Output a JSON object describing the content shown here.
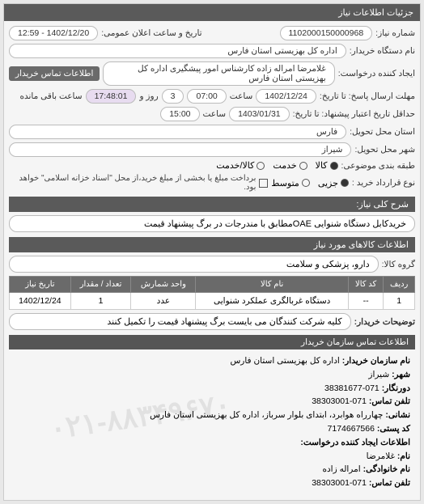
{
  "panel_title": "جزئیات اطلاعات نیاز",
  "header": {
    "req_no_label": "شماره نیاز:",
    "req_no": "1102000150000968",
    "public_announce_label": "تاریخ و ساعت اعلان عمومی:",
    "public_announce": "1402/12/20 - 12:59",
    "buyer_label": "نام دستگاه خریدار:",
    "buyer": "اداره کل بهزیستی استان فارس",
    "req_creator_label": "ایجاد کننده درخواست:",
    "req_creator": "غلامرضا امراله زاده کارشناس امور پیشگیری اداره کل بهزیستی استان فارس",
    "buyer_contact_btn": "اطلاعات تماس خریدار",
    "resp_deadline_label": "مهلت ارسال پاسخ: تا تاریخ:",
    "resp_date": "1402/12/24",
    "resp_time_label": "ساعت",
    "resp_time": "07:00",
    "resp_days_label": "روز و",
    "resp_days": "3",
    "remaining_label": "ساعت باقی مانده",
    "remaining": "17:48:01",
    "to_date_label": "حداقل تاریخ اعتبار پیشنهاد: تا تاریخ:",
    "to_date": "1403/01/31",
    "to_time_label": "ساعت",
    "to_time": "15:00",
    "province_label": "استان محل تحویل:",
    "province": "فارس",
    "city_label": "شهر محل تحویل:",
    "city": "شیراز",
    "category_label": "طبقه بندی موضوعی:",
    "cat_goods": "کالا",
    "cat_service": "خدمت",
    "cat_both": "کالا/خدمت",
    "priority_label": "نوع قرارداد خرید :",
    "p_minor": "جزیی",
    "p_med": "متوسط",
    "p_note": "برداخت مبلغ یا بخشی از مبلغ خرید،از محل \"اسناد خزانه اسلامی\" خواهد بود.",
    "desc_label": "شرح کلی نیاز:",
    "desc": "خریدکابل دستگاه شنوایی OAEمطابق با مندرجات در برگ پیشنهاد قیمت"
  },
  "goods_section": "اطلاعات کالاهای مورد نیاز",
  "goods_group_label": "گروه کالا:",
  "goods_group": "دارو، پزشکی و سلامت",
  "table": {
    "headers": [
      "ردیف",
      "کد کالا",
      "نام کالا",
      "واحد شمارش",
      "تعداد / مقدار",
      "تاریخ نیاز"
    ],
    "row": [
      "1",
      "--",
      "دستگاه غربالگری عملکرد شنوایی",
      "عدد",
      "1",
      "1402/12/24"
    ]
  },
  "buyer_note_label": "توضیحات خریدار:",
  "buyer_note": "کلیه شرکت کنندگان می بایست برگ پیشنهاد قیمت را تکمیل کنند",
  "contact": {
    "section": "اطلاعات تماس سازمان خریدار",
    "org_label": "نام سازمان خریدار:",
    "org": "اداره کل بهزیستی استان فارس",
    "city_label": "شهر:",
    "city": "شیراز",
    "fax_label": "دورنگار:",
    "fax": "071-38381677",
    "tel_label": "تلفن تماس:",
    "tel": "071-38303001",
    "addr_label": "نشانی:",
    "addr": "چهارراه هوابرد، ابتدای بلوار سرباز، اداره کل بهزیستی استان فارس",
    "post_label": "کد پستی:",
    "post": "7174667566",
    "creator_section": "اطلاعات ایجاد کننده درخواست:",
    "name_label": "نام:",
    "name": "غلامرضا",
    "family_label": "نام خانوادگی:",
    "family": "امراله زاده",
    "ctel_label": "تلفن تماس:",
    "ctel": "071-38303001"
  },
  "watermark": "۰۲۱-۸۸۳۴۹۶۷۰"
}
